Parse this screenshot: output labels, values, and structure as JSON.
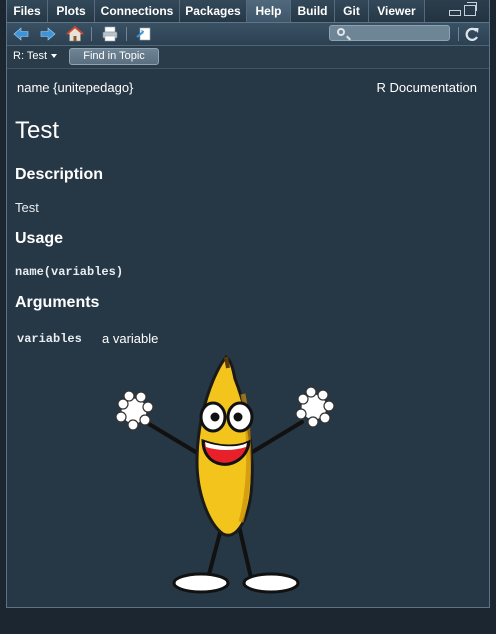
{
  "tabs": [
    {
      "label": "Files",
      "active": false
    },
    {
      "label": "Plots",
      "active": false
    },
    {
      "label": "Connections",
      "active": false
    },
    {
      "label": "Packages",
      "active": false
    },
    {
      "label": "Help",
      "active": true
    },
    {
      "label": "Build",
      "active": false
    },
    {
      "label": "Git",
      "active": false
    },
    {
      "label": "Viewer",
      "active": false
    }
  ],
  "toolbar": {
    "icons": [
      "back-arrow-icon",
      "forward-arrow-icon",
      "home-icon",
      "print-icon",
      "popout-icon",
      "search-icon",
      "refresh-icon"
    ],
    "search_value": ""
  },
  "topic": {
    "current": "R: Test",
    "find_label": "Find in Topic"
  },
  "doc": {
    "header_left": "name {unitepedago}",
    "header_right": "R Documentation",
    "title": "Test",
    "description_heading": "Description",
    "description_text": "Test",
    "usage_heading": "Usage",
    "usage_code": "name(variables)",
    "arguments_heading": "Arguments",
    "arguments": [
      {
        "name": "variables",
        "desc": "a variable"
      }
    ]
  },
  "colors": {
    "background": "#263745",
    "text": "#ffffff",
    "banana_yellow": "#f3c51c"
  }
}
